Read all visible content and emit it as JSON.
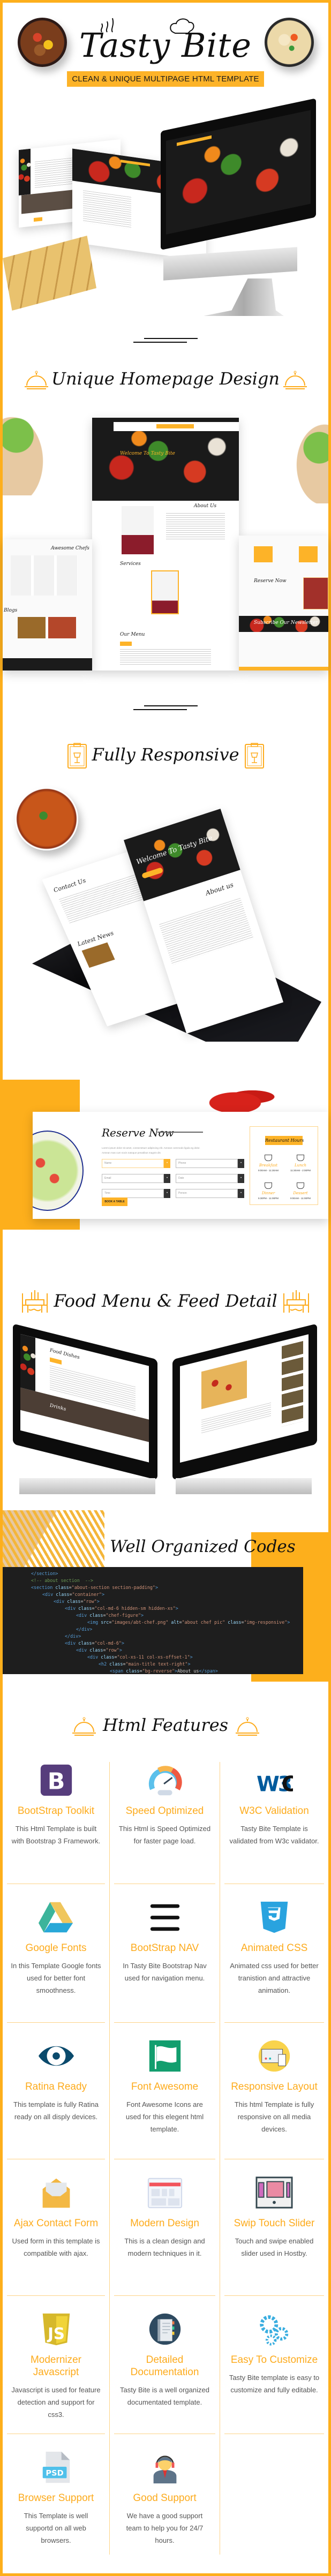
{
  "brand": {
    "logo": "Tasty Bite",
    "tagline": "CLEAN & UNIQUE MULTIPAGE HTML TEMPLATE"
  },
  "colors": {
    "accent": "#fdb328",
    "border": "#fdaf1c",
    "feature_title": "#fdab1c",
    "code_bg": "#1e1e1e"
  },
  "sections": {
    "homepage": {
      "title": "Unique Homepage Design",
      "mock_labels": [
        "Welcome To Tasty Bite",
        "About Us",
        "Services",
        "Our Menu",
        "Awesome Chefs",
        "Blogs",
        "Reserve Now",
        "Subscribe Our Newsletter"
      ]
    },
    "responsive": {
      "title": "Fully Responsive",
      "mock_labels": [
        "Welcome To Tasty Bite",
        "About us",
        "Contact Us",
        "Latest News"
      ]
    },
    "reserve": {
      "title": "Reserve Now",
      "intro": "Lorem ipsum dolor sit amet, consectetuer adipiscing elit. Aenean commodo ligula eg dolor. Aenean mas cum socis natoque penatibus magnis dis",
      "fields": [
        {
          "placeholder": "Name",
          "icon": "pencil-icon"
        },
        {
          "placeholder": "Phone",
          "icon": "phone-icon"
        },
        {
          "placeholder": "Email",
          "icon": "envelope-icon"
        },
        {
          "placeholder": "Date",
          "icon": "calendar-icon"
        },
        {
          "placeholder": "Time",
          "icon": "clock-icon"
        },
        {
          "placeholder": "Person",
          "icon": "user-icon"
        }
      ],
      "button": "BOOK A TABLE",
      "hours_title": "Restaurant Hours",
      "hours": [
        {
          "meal": "Breakfast",
          "time": "9:00AM - 11:30AM"
        },
        {
          "meal": "Lunch",
          "time": "11:30AM - 2:00PM"
        },
        {
          "meal": "Dinner",
          "time": "5:30PM - 11:00PM"
        },
        {
          "meal": "Dessert",
          "time": "9:00AM - 11:00PM"
        }
      ]
    },
    "menu": {
      "title": "Food Menu & Feed Detail",
      "mock_labels": [
        "Food Dishes",
        "Drinks"
      ]
    },
    "code": {
      "title": "Well Organized Codes",
      "lines": [
        {
          "indent": 2,
          "text": "</section>"
        },
        {
          "indent": 2,
          "text": "<!-- about section  -->"
        },
        {
          "indent": 2,
          "text": "<section class=\"about-section section-padding\">"
        },
        {
          "indent": 3,
          "text": "<div class=\"container\">"
        },
        {
          "indent": 4,
          "text": "<div class=\"row\">"
        },
        {
          "indent": 5,
          "text": "<div class=\"col-md-6 hidden-sm hidden-xs\">"
        },
        {
          "indent": 6,
          "text": "<div class=\"chef-figure\">"
        },
        {
          "indent": 7,
          "text": "<img src=\"images/abt-chef.png\" alt=\"about chef pic\" class=\"img-responsive\">"
        },
        {
          "indent": 6,
          "text": "</div>"
        },
        {
          "indent": 5,
          "text": "</div>"
        },
        {
          "indent": 5,
          "text": "<div class=\"col-md-6\">"
        },
        {
          "indent": 6,
          "text": "<div class=\"row\">"
        },
        {
          "indent": 7,
          "text": "<div class=\"col-xs-11 col-xs-offset-1\">"
        },
        {
          "indent": 8,
          "text": "<h2 class=\"main-title text-right\">"
        },
        {
          "indent": 9,
          "text": "<span class=\"bg-reverse\">About us</span>"
        }
      ]
    },
    "features": {
      "title": "Html Features",
      "items": [
        {
          "icon": "bootstrap-icon",
          "title": "BootStrap Toolkit",
          "desc": "This Html Template is built with Bootstrap 3 Framework."
        },
        {
          "icon": "speedometer-icon",
          "title": "Speed Optimized",
          "desc": "This Html is Speed Optimized for faster page load."
        },
        {
          "icon": "w3c-icon",
          "title": "W3C Validation",
          "desc": "Tasty Bite Template is validated from W3c validator."
        },
        {
          "icon": "google-drive-icon",
          "title": "Google Fonts",
          "desc": "In this Template Google fonts used for better font smoothness."
        },
        {
          "icon": "hamburger-menu-icon",
          "title": "BootStrap NAV",
          "desc": "In Tasty Bite Bootstrap Nav used for navigation menu."
        },
        {
          "icon": "css3-icon",
          "title": "Animated CSS",
          "desc": "Animated css used for better tranistion and attractive animation."
        },
        {
          "icon": "eye-icon",
          "title": "Ratina Ready",
          "desc": "This template is fully Ratina ready on all disply devices."
        },
        {
          "icon": "flag-icon",
          "title": "Font Awesome",
          "desc": "Font Awesome Icons are used for this elegent html template."
        },
        {
          "icon": "responsive-devices-icon",
          "title": "Responsive Layout",
          "desc": "This html Template is fully responsive on all media devices."
        },
        {
          "icon": "envelope-icon",
          "title": "Ajax Contact Form",
          "desc": "Used form in this template is compatible with ajax."
        },
        {
          "icon": "browser-layout-icon",
          "title": "Modern Design",
          "desc": "This is a clean design and modern techniques in it."
        },
        {
          "icon": "slider-icon",
          "title": "Swip Touch Slider",
          "desc": "Touch and swipe enabled slider used in Hostby."
        },
        {
          "icon": "javascript-icon",
          "title": "Modernizer Javascript",
          "desc": "Javascript is used for feature detection and support for css3."
        },
        {
          "icon": "notebook-icon",
          "title": "Detailed Documentation",
          "desc": "Tasty Bite is a well organized documentated template."
        },
        {
          "icon": "gears-icon",
          "title": "Easy To Customize",
          "desc": "Tasty Bite template is easy to customize and fully editable."
        },
        {
          "icon": "psd-file-icon",
          "title": "Browser Support",
          "desc": "This Template is well supportd on all web browsers."
        },
        {
          "icon": "support-agent-icon",
          "title": "Good Support",
          "desc": "We have a good support team to help you for 24/7 hours."
        }
      ]
    }
  }
}
